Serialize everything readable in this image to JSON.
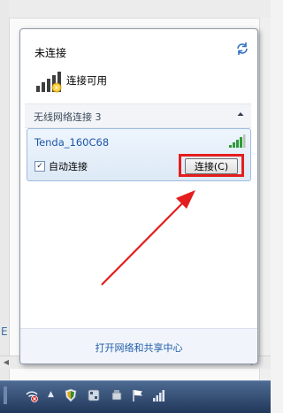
{
  "flyout": {
    "title": "未连接",
    "refresh_icon": "refresh-icon",
    "available_label": "连接可用",
    "group": {
      "label": "无线网络连接 3",
      "collapse_icon": "chevron-up-icon"
    },
    "network": {
      "ssid": "Tenda_160C68",
      "signal_icon": "wifi-signal-icon",
      "auto_connect_checked": true,
      "auto_connect_label": "自动连接",
      "connect_button": "连接(C)"
    },
    "footer_link": "打开网络和共享中心"
  },
  "annotation": {
    "highlight_color": "#e41e1e"
  },
  "taskbar": {
    "icons": [
      "network-no-access-icon",
      "show-hidden-icons-icon",
      "shield-icon",
      "app-icon",
      "usb-icon",
      "flag-icon",
      "signal-icon"
    ]
  },
  "colors": {
    "link": "#1e5da8",
    "ssid": "#1b57a8",
    "taskbar": "#2b4466"
  }
}
